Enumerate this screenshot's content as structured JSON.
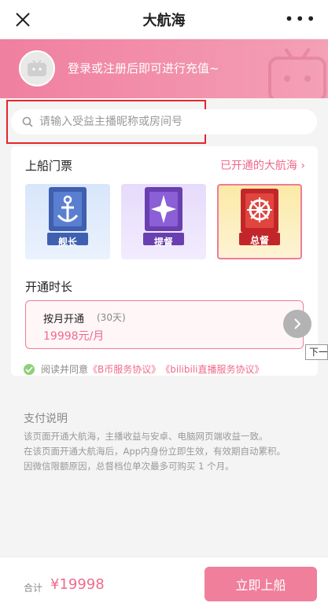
{
  "titlebar": {
    "title": "大航海",
    "more": "•••"
  },
  "banner": {
    "login_text": "登录或注册后即可进行充值~"
  },
  "search": {
    "placeholder": "请输入受益主播昵称或房间号"
  },
  "tickets": {
    "section_title": "上船门票",
    "opened_link": "已开通的大航海",
    "items": [
      {
        "label": "舰长",
        "selected": false,
        "color": "#3f5fb0"
      },
      {
        "label": "提督",
        "selected": false,
        "color": "#6a3fb0"
      },
      {
        "label": "总督",
        "selected": true,
        "color": "#c2262b"
      }
    ]
  },
  "duration": {
    "section_title": "开通时长",
    "option_name": "按月开通",
    "option_days": "(30天)",
    "option_price": "19998元/月"
  },
  "tooltip": "下一",
  "agree": {
    "prefix": "阅读并同意",
    "link1": "《B币服务协议》",
    "link2": "《bilibili直播服务协议》"
  },
  "pay_info": {
    "title": "支付说明",
    "lines": [
      "该页面开通大航海，主播收益与安卓、电脑网页端收益一致。",
      "在该页面开通大航海后，App内身份立即生效，有效期自动累积。",
      "因微信限额原因，总督档位单次最多可购买 1 个月。"
    ]
  },
  "bottom": {
    "total_label": "合计",
    "total_value": "¥19998",
    "buy_label": "立即上船"
  },
  "colors": {
    "accent": "#f06a8c",
    "banner": "#f07fa0",
    "highlight_box": "#e4262b"
  }
}
